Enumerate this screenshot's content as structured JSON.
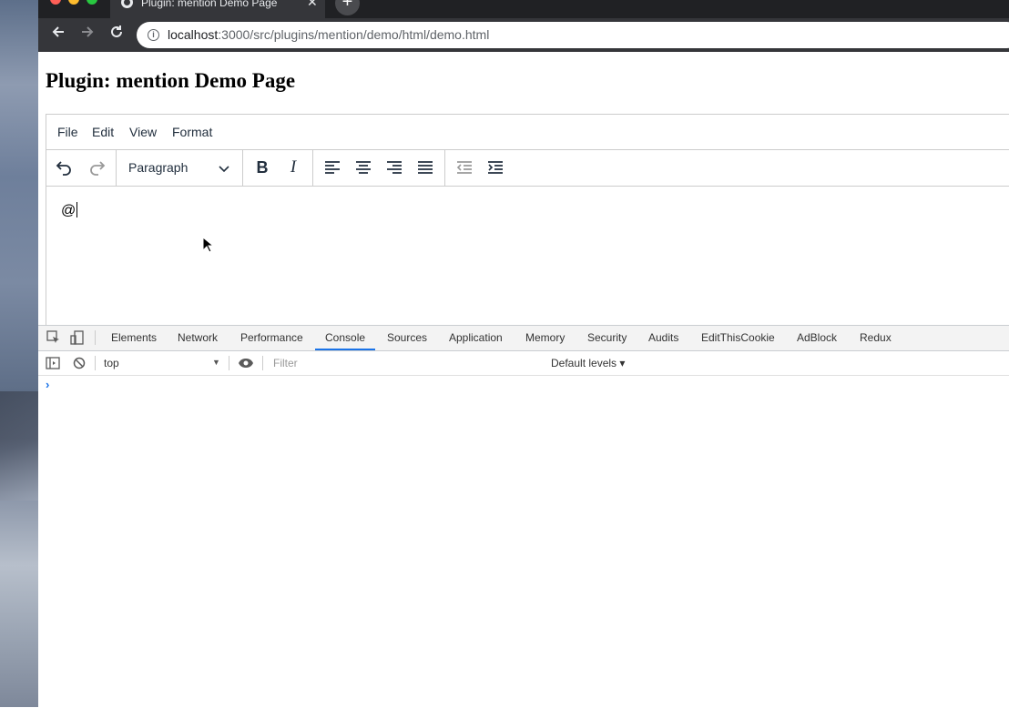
{
  "browser": {
    "tab_title": "Plugin: mention Demo Page",
    "tab_close": "✕",
    "new_tab": "+",
    "url_host": "localhost",
    "url_path": ":3000/src/plugins/mention/demo/html/demo.html"
  },
  "page": {
    "title": "Plugin: mention Demo Page"
  },
  "editor": {
    "menu": [
      "File",
      "Edit",
      "View",
      "Format"
    ],
    "block_format": "Paragraph",
    "content": "@"
  },
  "devtools": {
    "tabs": [
      "Elements",
      "Network",
      "Performance",
      "Console",
      "Sources",
      "Application",
      "Memory",
      "Security",
      "Audits",
      "EditThisCookie",
      "AdBlock",
      "Redux"
    ],
    "active_tab": "Console",
    "context": "top",
    "filter_placeholder": "Filter",
    "levels": "Default levels ▾",
    "prompt": "›"
  },
  "colors": {
    "accent": "#1a73e8",
    "chrome_dark": "#35363a"
  }
}
